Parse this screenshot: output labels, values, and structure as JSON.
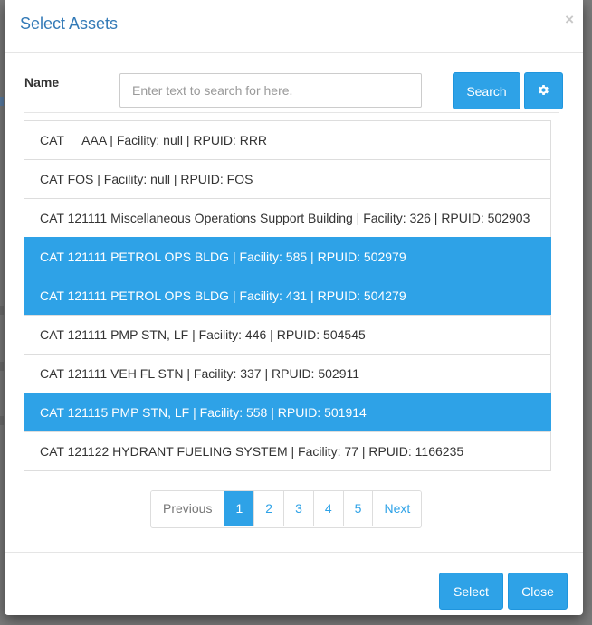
{
  "modal": {
    "title": "Select Assets",
    "close_glyph": "×"
  },
  "filter": {
    "name_label": "Name",
    "search_placeholder": "Enter text to search for here.",
    "search_value": "",
    "search_button": "Search",
    "settings_icon": "gear-icon"
  },
  "assets": [
    {
      "label": "CAT __AAA | Facility: null | RPUID: RRR",
      "selected": false
    },
    {
      "label": "CAT FOS | Facility: null | RPUID: FOS",
      "selected": false
    },
    {
      "label": "CAT 121111 Miscellaneous Operations Support Building | Facility: 326 | RPUID: 502903",
      "selected": false
    },
    {
      "label": "CAT 121111 PETROL OPS BLDG | Facility: 585 | RPUID: 502979",
      "selected": true
    },
    {
      "label": "CAT 121111 PETROL OPS BLDG | Facility: 431 | RPUID: 504279",
      "selected": true
    },
    {
      "label": "CAT 121111 PMP STN, LF | Facility: 446 | RPUID: 504545",
      "selected": false
    },
    {
      "label": "CAT 121111 VEH FL STN | Facility: 337 | RPUID: 502911",
      "selected": false
    },
    {
      "label": "CAT 121115 PMP STN, LF | Facility: 558 | RPUID: 501914",
      "selected": true
    },
    {
      "label": "CAT 121122 HYDRANT FUELING SYSTEM | Facility: 77 | RPUID: 1166235",
      "selected": false
    }
  ],
  "pagination": {
    "previous": "Previous",
    "pages": [
      "1",
      "2",
      "3",
      "4",
      "5"
    ],
    "active_page": "1",
    "next": "Next"
  },
  "footer": {
    "select_button": "Select",
    "close_button": "Close"
  },
  "colors": {
    "accent": "#2ea2e7",
    "title": "#337ab7"
  }
}
